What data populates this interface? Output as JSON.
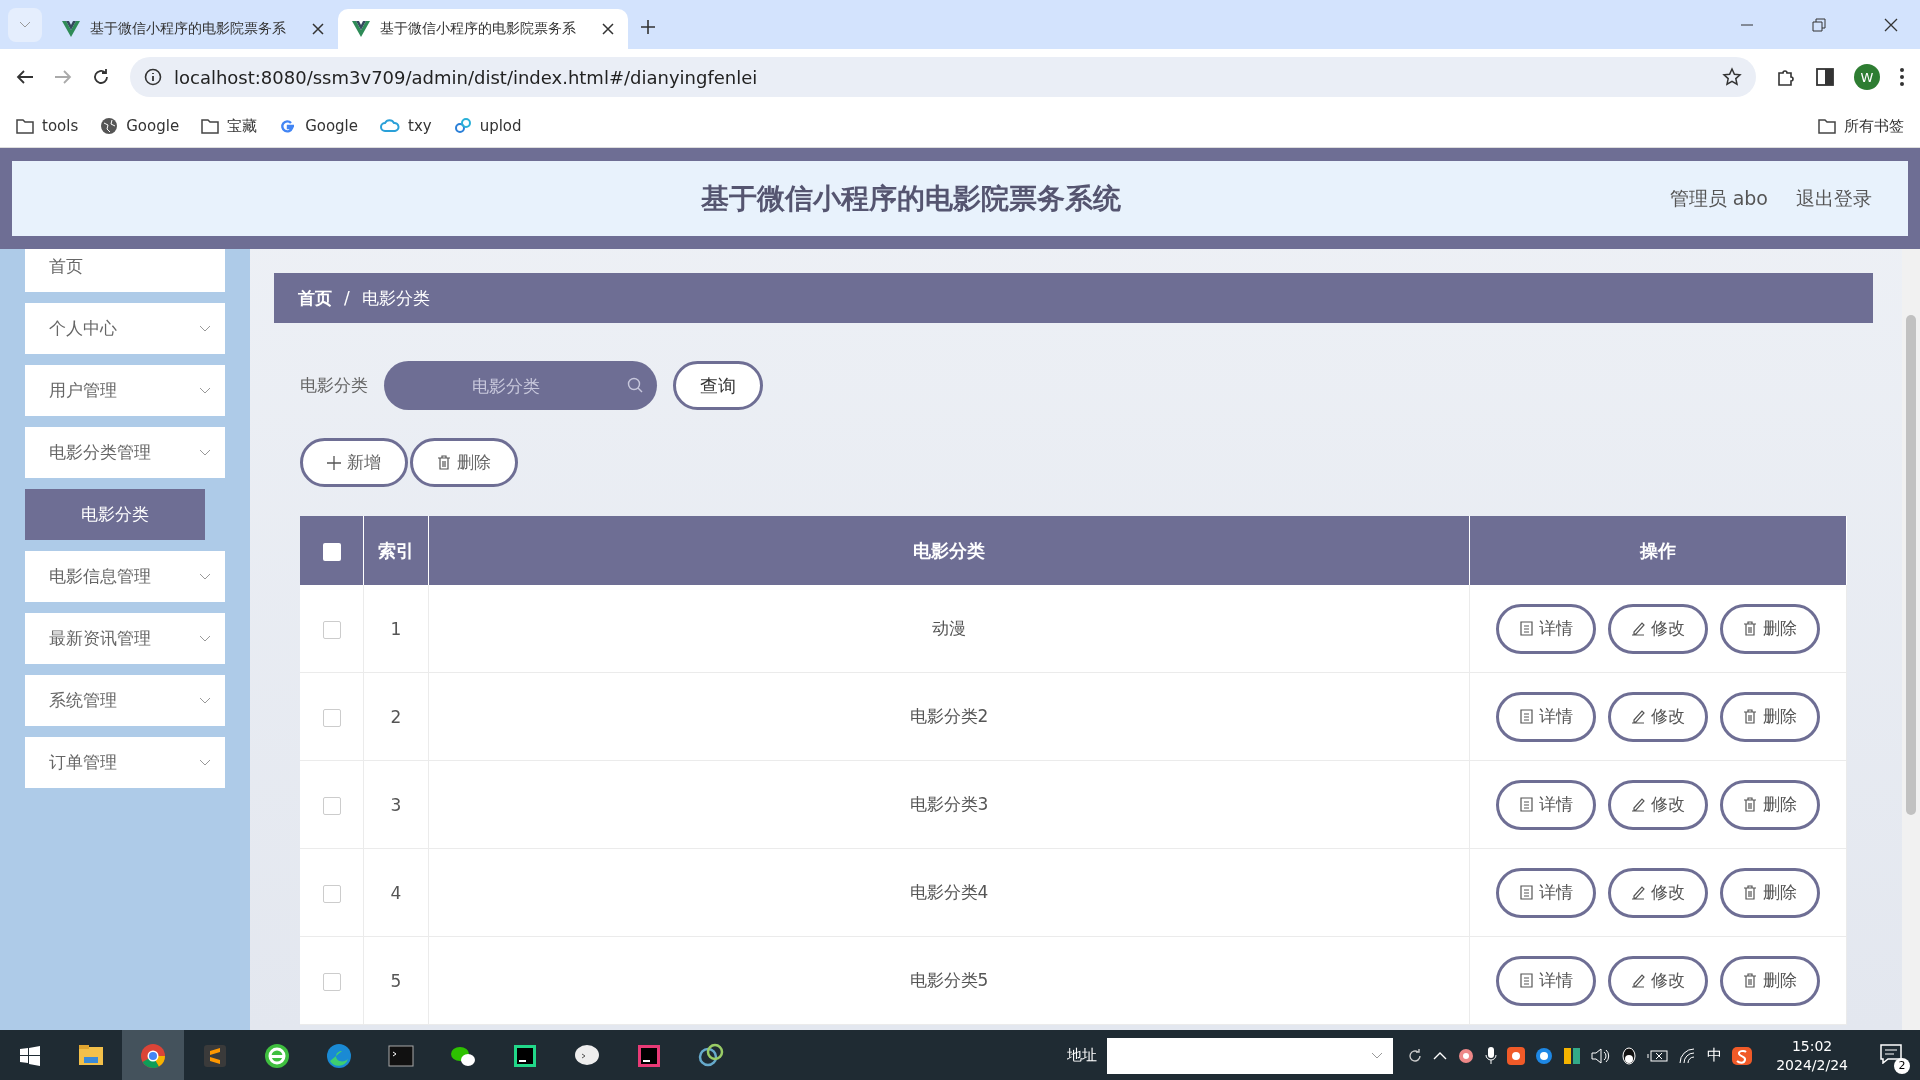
{
  "browser": {
    "tabs": [
      {
        "title": "基于微信小程序的电影院票务系",
        "selected": false
      },
      {
        "title": "基于微信小程序的电影院票务系",
        "selected": true
      }
    ],
    "url": "localhost:8080/ssm3v709/admin/dist/index.html#/dianyingfenlei",
    "profile": "W",
    "bookmarks": [
      {
        "label": "tools",
        "kind": "folder"
      },
      {
        "label": "Google",
        "kind": "globe"
      },
      {
        "label": "宝藏",
        "kind": "folder"
      },
      {
        "label": "Google",
        "kind": "google"
      },
      {
        "label": "txy",
        "kind": "cloud"
      },
      {
        "label": "uplod",
        "kind": "link"
      }
    ],
    "all_bookmarks": "所有书签"
  },
  "header": {
    "title": "基于微信小程序的电影院票务系统",
    "user": "管理员 abo",
    "logout": "退出登录"
  },
  "sidebar": {
    "items": [
      {
        "label": "首页",
        "kind": "single"
      },
      {
        "label": "个人中心",
        "kind": "group"
      },
      {
        "label": "用户管理",
        "kind": "group"
      },
      {
        "label": "电影分类管理",
        "kind": "group",
        "children": [
          {
            "label": "电影分类",
            "selected": true
          }
        ]
      },
      {
        "label": "电影信息管理",
        "kind": "group"
      },
      {
        "label": "最新资讯管理",
        "kind": "group"
      },
      {
        "label": "系统管理",
        "kind": "group"
      },
      {
        "label": "订单管理",
        "kind": "group"
      }
    ]
  },
  "breadcrumb": {
    "items": [
      "首页",
      "电影分类"
    ],
    "separator": "/"
  },
  "search": {
    "label": "电影分类",
    "placeholder": "电影分类",
    "button": "查询"
  },
  "actions": [
    {
      "label": "新增",
      "kind": "add"
    },
    {
      "label": "删除",
      "kind": "delete"
    }
  ],
  "table": {
    "select_all": {
      "checked": false
    },
    "columns": [
      "索引",
      "电影分类",
      "操作"
    ],
    "rows": [
      {
        "index": "1",
        "name": "动漫",
        "checked": false,
        "actions": [
          {
            "label": "详情",
            "kind": "detail"
          },
          {
            "label": "修改",
            "kind": "edit"
          },
          {
            "label": "删除",
            "kind": "delete"
          }
        ]
      },
      {
        "index": "2",
        "name": "电影分类2",
        "checked": false,
        "actions": [
          {
            "label": "详情",
            "kind": "detail"
          },
          {
            "label": "修改",
            "kind": "edit"
          },
          {
            "label": "删除",
            "kind": "delete"
          }
        ]
      },
      {
        "index": "3",
        "name": "电影分类3",
        "checked": false,
        "actions": [
          {
            "label": "详情",
            "kind": "detail"
          },
          {
            "label": "修改",
            "kind": "edit"
          },
          {
            "label": "删除",
            "kind": "delete"
          }
        ]
      },
      {
        "index": "4",
        "name": "电影分类4",
        "checked": false,
        "actions": [
          {
            "label": "详情",
            "kind": "detail"
          },
          {
            "label": "修改",
            "kind": "edit"
          },
          {
            "label": "删除",
            "kind": "delete"
          }
        ]
      },
      {
        "index": "5",
        "name": "电影分类5",
        "checked": false,
        "actions": [
          {
            "label": "详情",
            "kind": "detail"
          },
          {
            "label": "修改",
            "kind": "edit"
          },
          {
            "label": "删除",
            "kind": "delete"
          }
        ]
      }
    ]
  },
  "taskbar": {
    "apps": [
      {
        "kind": "files",
        "selected": false
      },
      {
        "kind": "chrome",
        "selected": true
      },
      {
        "kind": "sublime",
        "selected": false
      },
      {
        "kind": "ie",
        "selected": false
      },
      {
        "kind": "edge",
        "selected": false
      },
      {
        "kind": "terminal",
        "selected": false
      },
      {
        "kind": "wechat",
        "selected": false
      },
      {
        "kind": "pycharm",
        "selected": false
      },
      {
        "kind": "chat",
        "selected": false
      },
      {
        "kind": "idea",
        "selected": false
      },
      {
        "kind": "navicat",
        "selected": false
      }
    ],
    "address_label": "地址",
    "ime": "中",
    "time": "15:02",
    "date": "2024/2/24",
    "notifications": "2"
  }
}
